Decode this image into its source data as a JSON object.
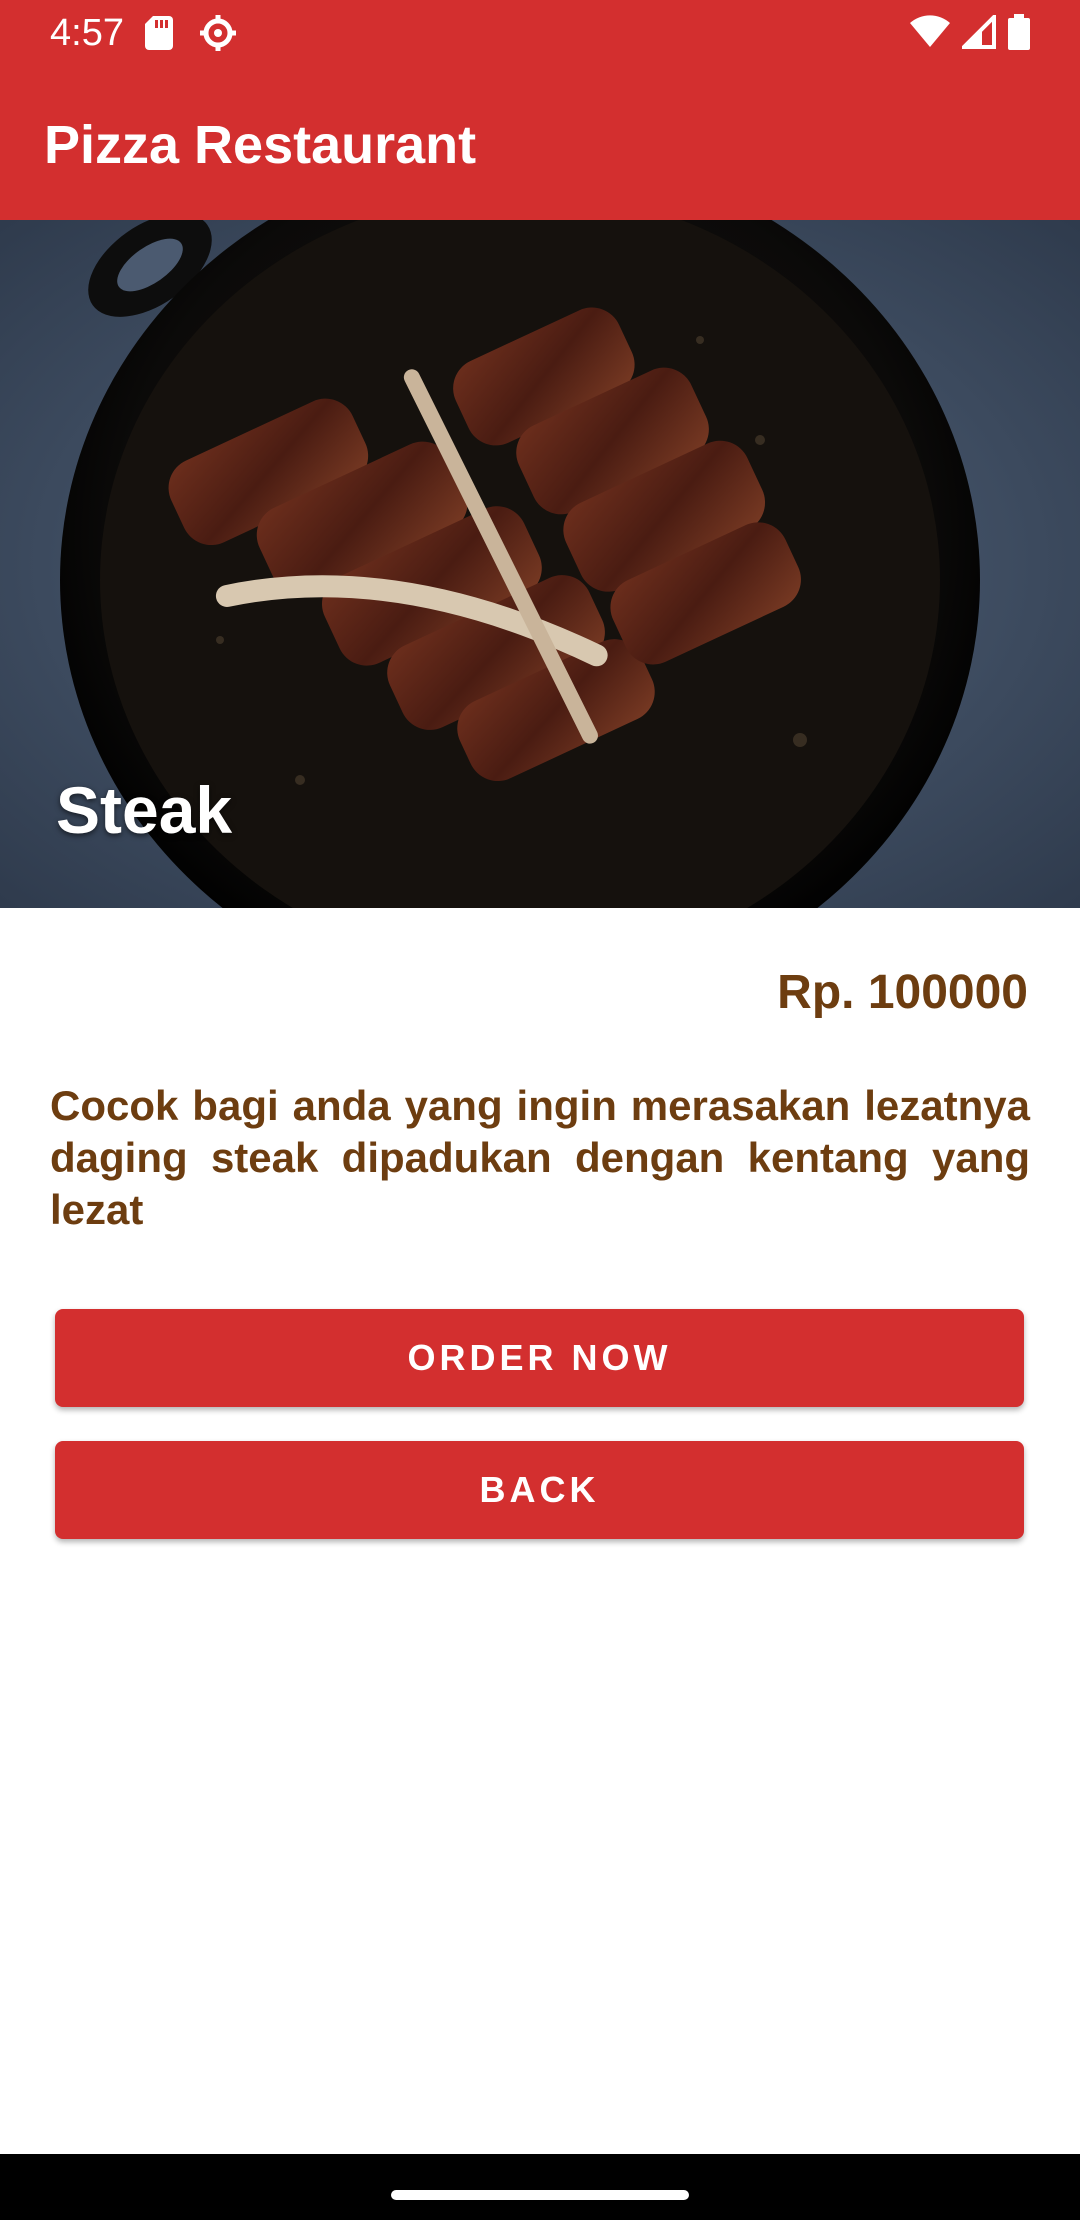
{
  "status_bar": {
    "time": "4:57",
    "icons": [
      "sd-card-icon",
      "settings-icon",
      "wifi-icon",
      "signal-icon",
      "battery-icon"
    ]
  },
  "app_bar": {
    "title": "Pizza Restaurant"
  },
  "hero": {
    "title": "Steak",
    "image": "steak-in-skillet"
  },
  "product": {
    "price": "Rp. 100000",
    "description": "Cocok bagi anda yang ingin merasakan lezatnya daging steak dipadukan dengan kentang yang lezat"
  },
  "buttons": {
    "order_now": "ORDER NOW",
    "back": "BACK"
  },
  "colors": {
    "primary": "#d32f2f",
    "text_brown": "#6d3d10"
  }
}
